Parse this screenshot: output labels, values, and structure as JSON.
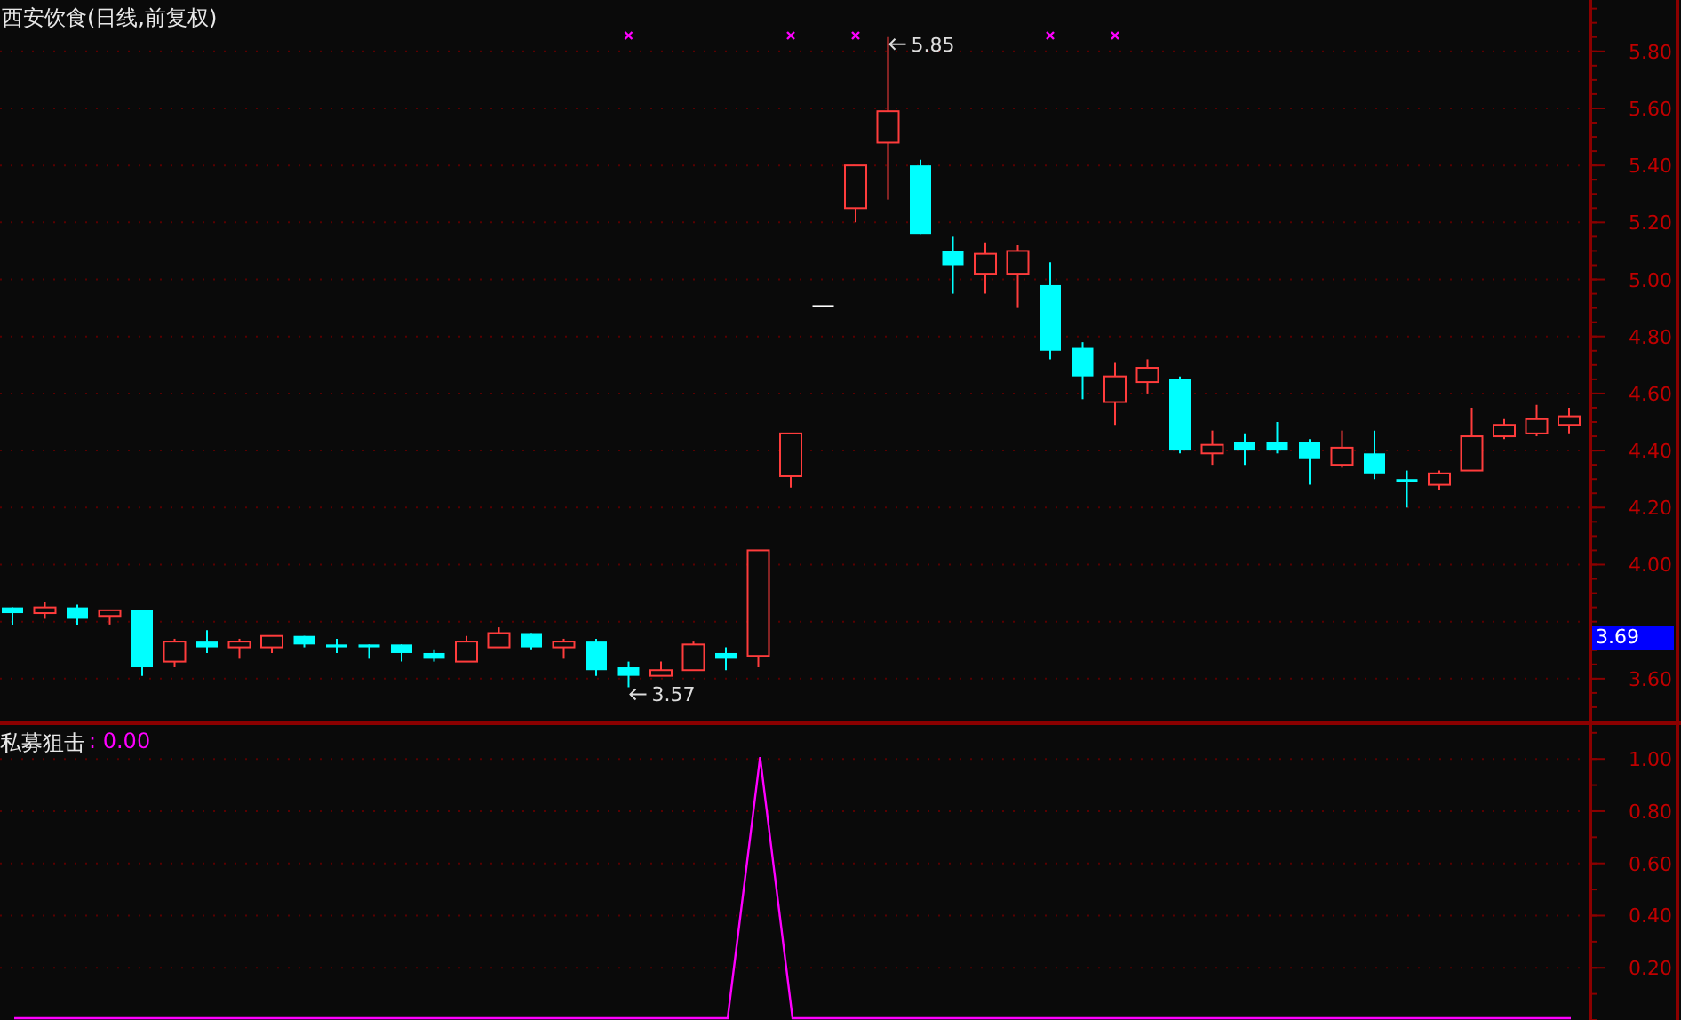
{
  "price_panel": {
    "title": "西安饮食(日线,前复权)",
    "current_price_label": "3.69",
    "chart_data": {
      "type": "candlestick",
      "grid": true,
      "ylim": [
        3.45,
        5.98
      ],
      "yticks": [
        {
          "value": 3.6,
          "label": "3.60"
        },
        {
          "value": 4.0,
          "label": "4.00"
        },
        {
          "value": 4.2,
          "label": "4.20"
        },
        {
          "value": 4.4,
          "label": "4.40"
        },
        {
          "value": 4.6,
          "label": "4.60"
        },
        {
          "value": 4.8,
          "label": "4.80"
        },
        {
          "value": 5.0,
          "label": "5.00"
        },
        {
          "value": 5.2,
          "label": "5.20"
        },
        {
          "value": 5.4,
          "label": "5.40"
        },
        {
          "value": 5.6,
          "label": "5.60"
        },
        {
          "value": 5.8,
          "label": "5.80"
        }
      ],
      "ohlc": [
        [
          3.85,
          3.85,
          3.79,
          3.83
        ],
        [
          3.83,
          3.87,
          3.81,
          3.85
        ],
        [
          3.85,
          3.86,
          3.79,
          3.81
        ],
        [
          3.82,
          3.84,
          3.79,
          3.84
        ],
        [
          3.84,
          3.84,
          3.61,
          3.64
        ],
        [
          3.66,
          3.74,
          3.64,
          3.73
        ],
        [
          3.73,
          3.77,
          3.69,
          3.71
        ],
        [
          3.71,
          3.74,
          3.67,
          3.73
        ],
        [
          3.71,
          3.75,
          3.69,
          3.75
        ],
        [
          3.75,
          3.75,
          3.71,
          3.72
        ],
        [
          3.72,
          3.74,
          3.69,
          3.71
        ],
        [
          3.72,
          3.72,
          3.67,
          3.71
        ],
        [
          3.72,
          3.72,
          3.66,
          3.69
        ],
        [
          3.69,
          3.7,
          3.66,
          3.67
        ],
        [
          3.66,
          3.75,
          3.66,
          3.73
        ],
        [
          3.71,
          3.78,
          3.71,
          3.76
        ],
        [
          3.76,
          3.76,
          3.7,
          3.71
        ],
        [
          3.71,
          3.74,
          3.67,
          3.73
        ],
        [
          3.73,
          3.74,
          3.61,
          3.63
        ],
        [
          3.64,
          3.66,
          3.57,
          3.61
        ],
        [
          3.61,
          3.66,
          3.61,
          3.63
        ],
        [
          3.63,
          3.73,
          3.63,
          3.72
        ],
        [
          3.69,
          3.71,
          3.63,
          3.67
        ],
        [
          3.68,
          4.05,
          3.64,
          4.05
        ],
        [
          4.31,
          4.46,
          4.27,
          4.46
        ],
        [
          4.91,
          4.91,
          4.91,
          4.91
        ],
        [
          5.25,
          5.4,
          5.2,
          5.4
        ],
        [
          5.48,
          5.85,
          5.28,
          5.59
        ],
        [
          5.4,
          5.42,
          5.16,
          5.16
        ],
        [
          5.1,
          5.15,
          4.95,
          5.05
        ],
        [
          5.02,
          5.13,
          4.95,
          5.09
        ],
        [
          5.02,
          5.12,
          4.9,
          5.1
        ],
        [
          4.98,
          5.06,
          4.72,
          4.75
        ],
        [
          4.76,
          4.78,
          4.58,
          4.66
        ],
        [
          4.57,
          4.71,
          4.49,
          4.66
        ],
        [
          4.64,
          4.72,
          4.6,
          4.69
        ],
        [
          4.65,
          4.66,
          4.39,
          4.4
        ],
        [
          4.39,
          4.47,
          4.35,
          4.42
        ],
        [
          4.43,
          4.46,
          4.35,
          4.4
        ],
        [
          4.43,
          4.5,
          4.39,
          4.4
        ],
        [
          4.43,
          4.44,
          4.28,
          4.37
        ],
        [
          4.35,
          4.47,
          4.34,
          4.41
        ],
        [
          4.39,
          4.47,
          4.3,
          4.32
        ],
        [
          4.3,
          4.33,
          4.2,
          4.29
        ],
        [
          4.28,
          4.33,
          4.26,
          4.32
        ],
        [
          4.33,
          4.55,
          4.33,
          4.45
        ],
        [
          4.45,
          4.51,
          4.44,
          4.49
        ],
        [
          4.46,
          4.56,
          4.45,
          4.51
        ],
        [
          4.49,
          4.55,
          4.46,
          4.52
        ]
      ],
      "annotations": [
        "5.85",
        "3.57"
      ]
    },
    "signal_marks": [
      false,
      false,
      false,
      false,
      false,
      false,
      false,
      false,
      false,
      false,
      false,
      false,
      false,
      false,
      false,
      false,
      false,
      false,
      false,
      true,
      false,
      false,
      false,
      false,
      true,
      false,
      true,
      false,
      false,
      false,
      false,
      false,
      true,
      false,
      true,
      false,
      false,
      false,
      false,
      false,
      false,
      false,
      false,
      false,
      false,
      false,
      false,
      false,
      false
    ]
  },
  "indicator_panel": {
    "value": ": 0.00",
    "chart_data": {
      "type": "line",
      "grid": true,
      "ylim": [
        0,
        1.13
      ],
      "yticks": [
        {
          "value": 0.2,
          "label": "0.20"
        },
        {
          "value": 0.4,
          "label": "0.40"
        },
        {
          "value": 0.6,
          "label": "0.60"
        },
        {
          "value": 0.8,
          "label": "0.80"
        },
        {
          "value": 1.0,
          "label": "1.00"
        }
      ],
      "series": [
        {
          "name": "私募狙击",
          "color": "#ff00ff",
          "values": [
            0,
            0,
            0,
            0,
            0,
            0,
            0,
            0,
            0,
            0,
            0,
            0,
            0,
            0,
            0,
            0,
            0,
            0,
            0,
            0,
            0,
            0,
            0,
            1,
            0,
            0,
            0,
            0,
            0,
            0,
            0,
            0,
            0,
            0,
            0,
            0,
            0,
            0,
            0,
            0,
            0,
            0,
            0,
            0,
            0,
            0,
            0,
            0,
            0
          ]
        }
      ]
    }
  }
}
